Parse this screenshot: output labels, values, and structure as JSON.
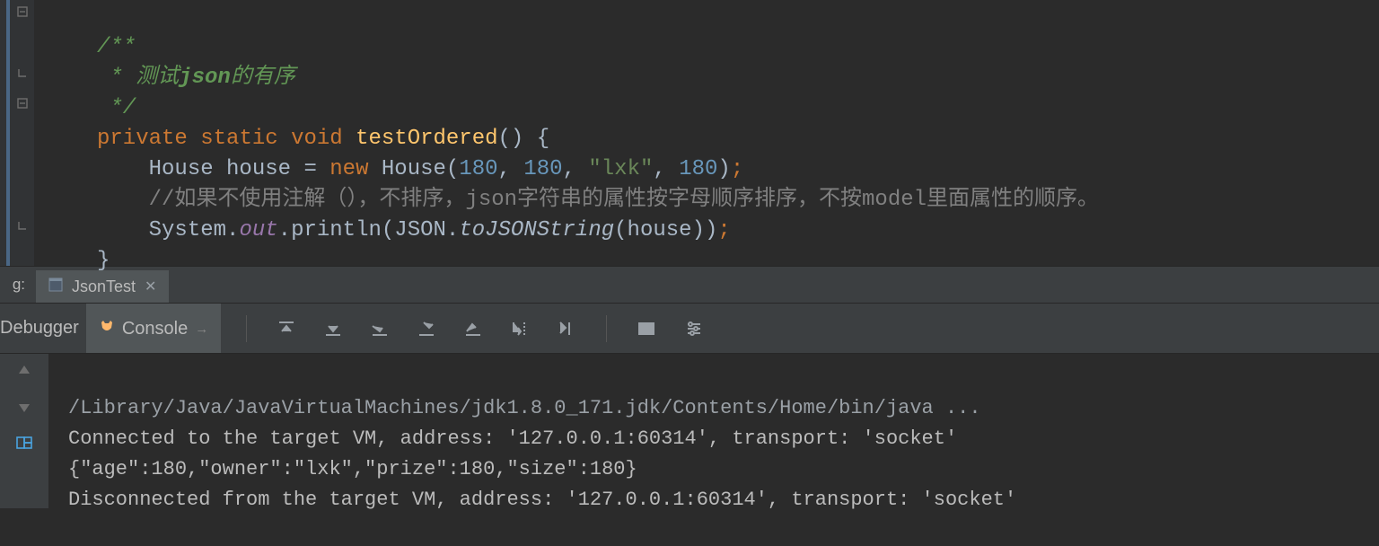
{
  "code": {
    "comment_open": "/**",
    "comment_body_prefix": " * ",
    "comment_body_cn1": "测试",
    "comment_body_json": "json",
    "comment_body_cn2": "的有序",
    "comment_close": " */",
    "kw_private": "private",
    "kw_static": "static",
    "kw_void": "void",
    "method_name": "testOrdered",
    "paren_open": "()",
    "brace_open": " {",
    "type_house": "House",
    "var_house": "house",
    "eq": " = ",
    "kw_new": "new",
    "ctor": "House",
    "arg1": "180",
    "arg2": "180",
    "arg3": "\"lxk\"",
    "arg4": "180",
    "line_comment": "//如果不使用注解（），不排序，json字符串的属性按字母顺序排序，不按model里面属性的顺序。",
    "system": "System",
    "out": "out",
    "println": "println",
    "json_cls": "JSON",
    "toJSONString": "toJSONString",
    "arg_house": "house",
    "brace_close": "}"
  },
  "run": {
    "side_label": "g:",
    "tab_name": "JsonTest"
  },
  "toolbar": {
    "debugger": "Debugger",
    "console": "Console",
    "arrow": "→"
  },
  "console": {
    "line1": "/Library/Java/JavaVirtualMachines/jdk1.8.0_171.jdk/Contents/Home/bin/java ...",
    "line2": "Connected to the target VM, address: '127.0.0.1:60314', transport: 'socket'",
    "line3": "{\"age\":180,\"owner\":\"lxk\",\"prize\":180,\"size\":180}",
    "line4": "Disconnected from the target VM, address: '127.0.0.1:60314', transport: 'socket'"
  }
}
